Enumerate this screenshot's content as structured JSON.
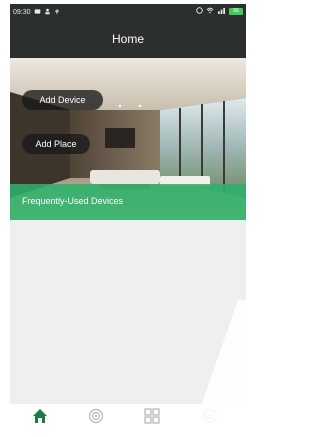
{
  "status_bar": {
    "time": "09:30",
    "battery_level": "56"
  },
  "header": {
    "title": "Home"
  },
  "hero": {
    "add_device_label": "Add Device",
    "add_place_label": "Add Place",
    "frequently_used_label": "Frequently-Used Devices"
  },
  "bottom_nav": {
    "items": [
      {
        "icon": "home-icon",
        "active": true
      },
      {
        "icon": "scenes-icon",
        "active": false
      },
      {
        "icon": "grid-icon",
        "active": false
      },
      {
        "icon": "settings-gear-icon",
        "active": false
      }
    ]
  },
  "colors": {
    "header_bg": "#2b302e",
    "accent_green": "#2eb06a",
    "active_nav": "#1e7a45",
    "inactive_nav": "#b5b5b5"
  }
}
